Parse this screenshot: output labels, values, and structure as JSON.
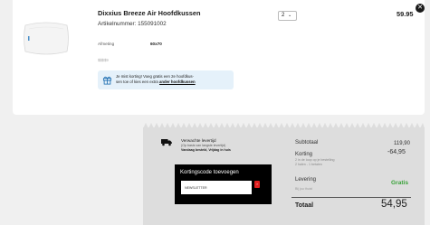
{
  "product": {
    "name": "Dixxius Breeze Air Hoofdkussen",
    "sku_label": "Artikelnummer: 155091002",
    "quantity": "2",
    "price": "59.95",
    "spec_label": "Afmeting",
    "spec_value": "60x70",
    "extra_code": "$$$$9",
    "remove_icon": "close-icon",
    "promo": {
      "icon": "gift-icon",
      "line1": "Je mist korting! Voeg gratis een 2e hoofdkus-",
      "line2_prefix": "sen toe of kies een extra ",
      "line2_link": "ander hoofdkussen"
    }
  },
  "delivery": {
    "icon": "truck-icon",
    "title": "Verwachte levertijd",
    "subtitle": "(Op basis van langste levertijd)",
    "detail": "Vandaag besteld, Vrijdag in huis"
  },
  "coupon": {
    "title": "Kortingscode toevoegen",
    "placeholder": "NEWSLETTER",
    "submit_icon": "arrow-right-icon"
  },
  "summary": {
    "subtotal_label": "Subtotaal",
    "subtotal_value": "119,90",
    "discount_label": "Korting",
    "discount_value": "-64,95",
    "discount_note1": "2 in de loop op je bestelling",
    "discount_note2": "2 halen - 1 betalen",
    "delivery_label": "Levering",
    "delivery_value": "Gratis",
    "delivery_note": "Bij jou thuis!",
    "total_label": "Totaal",
    "total_value": "54,95"
  },
  "colors": {
    "accent_red": "#e02020",
    "free_green": "#3aa23a",
    "promo_bg": "#e5f1fa"
  }
}
